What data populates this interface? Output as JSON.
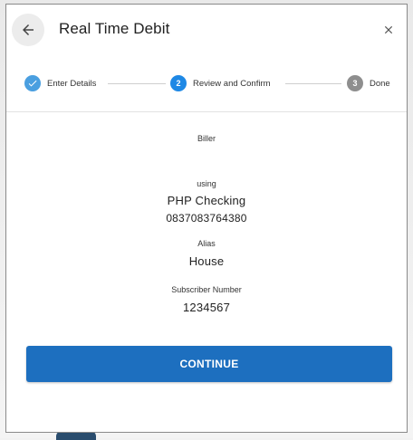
{
  "dialog": {
    "title": "Real Time Debit"
  },
  "stepper": {
    "steps": [
      {
        "label": "Enter Details",
        "state": "completed",
        "marker": "check-icon"
      },
      {
        "label": "Review and Confirm",
        "state": "active",
        "number": "2"
      },
      {
        "label": "Done",
        "state": "pending",
        "number": "3"
      }
    ]
  },
  "details": {
    "biller_label": "Biller",
    "using_label": "using",
    "account_name": "PHP Checking",
    "account_number": "0837083764380",
    "alias_label": "Alias",
    "alias_value": "House",
    "subscriber_label": "Subscriber Number",
    "subscriber_value": "1234567"
  },
  "actions": {
    "continue_label": "CONTINUE"
  },
  "colors": {
    "accent": "#1d6fbf",
    "step_complete": "#4a9fe0",
    "step_active": "#1e88e5",
    "step_pending": "#8e8e8e"
  },
  "icons": {
    "back": "arrow-left-icon",
    "close": "close-icon",
    "check": "check-icon"
  }
}
